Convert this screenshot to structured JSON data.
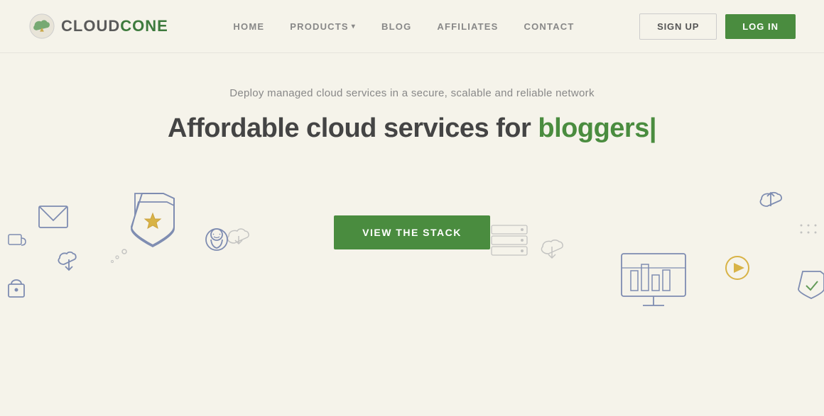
{
  "header": {
    "logo_cloud": "CLOUD",
    "logo_cone": "CONE",
    "nav": {
      "home": "HOME",
      "products": "PRODUCTS",
      "blog": "BLOG",
      "affiliates": "AFFILIATES",
      "contact": "CONTACT"
    },
    "signup_label": "SIGN UP",
    "login_label": "LOG IN"
  },
  "hero": {
    "subtitle": "Deploy managed cloud services in a secure, scalable and reliable network",
    "title_prefix": "Affordable cloud services for ",
    "title_highlight": "bloggers",
    "title_cursor": "|",
    "cta_label": "VIEW THE STACK"
  },
  "colors": {
    "accent_green": "#4a8c3f",
    "text_gray": "#888888",
    "text_dark": "#444444",
    "bg": "#f5f3ea"
  }
}
